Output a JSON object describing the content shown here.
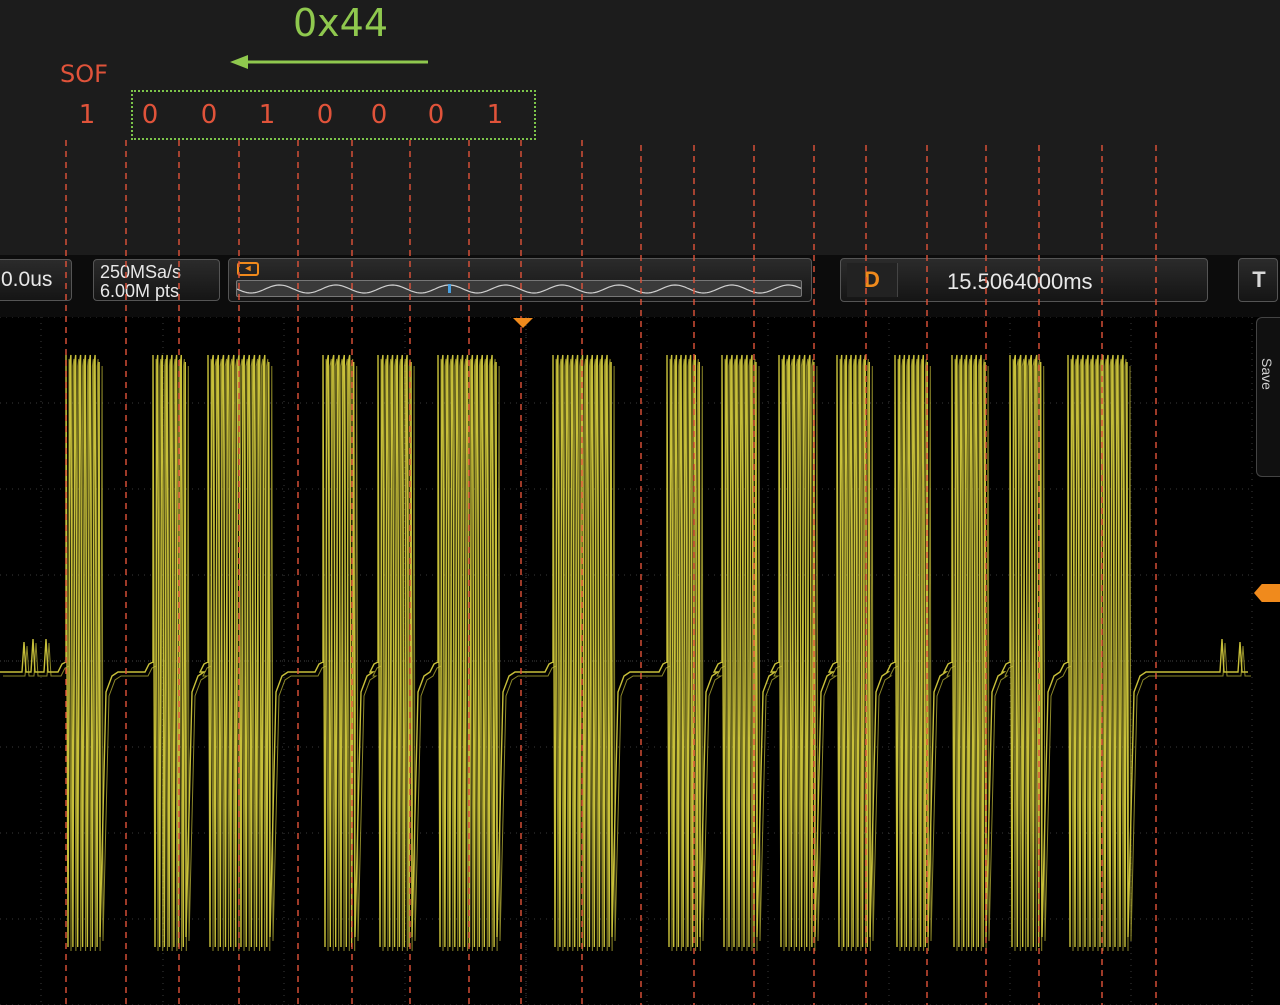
{
  "annotation": {
    "hex_value": "0x44",
    "sof_label": "SOF",
    "bits": [
      "1",
      "0",
      "0",
      "1",
      "0",
      "0",
      "0",
      "1"
    ],
    "colors": {
      "bits": "#e0533a",
      "byte": "#8fc84e"
    }
  },
  "toolbar": {
    "timebase": "0.0us",
    "sample_rate": "250MSa/s",
    "memory_depth": "6.00M pts",
    "delay": "15.5064000ms",
    "trigger_label": "T",
    "delay_icon": "D"
  },
  "side_tab": {
    "label": "Save"
  },
  "scope": {
    "waveform_color": "#c8c03a",
    "marker_color": "#e0533a"
  }
}
